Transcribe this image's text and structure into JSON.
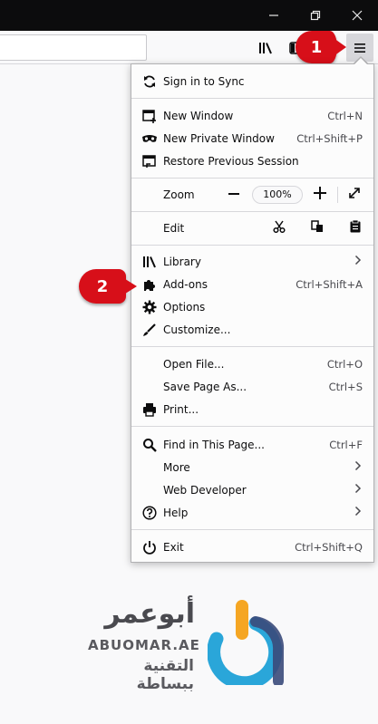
{
  "window_controls": {
    "minimize": "—",
    "maximize": "❐",
    "close": "✕"
  },
  "annotations": {
    "step1": "1",
    "step2": "2"
  },
  "menu": {
    "sign_in": "Sign in to Sync",
    "new_window": {
      "label": "New Window",
      "shortcut": "Ctrl+N"
    },
    "private_window": {
      "label": "New Private Window",
      "shortcut": "Ctrl+Shift+P"
    },
    "restore_session": {
      "label": "Restore Previous Session"
    },
    "zoom": {
      "label": "Zoom",
      "minus": "—",
      "value": "100%",
      "plus": "+"
    },
    "edit": {
      "label": "Edit"
    },
    "library": {
      "label": "Library"
    },
    "addons": {
      "label": "Add-ons",
      "shortcut": "Ctrl+Shift+A"
    },
    "options": {
      "label": "Options"
    },
    "customize": {
      "label": "Customize..."
    },
    "open_file": {
      "label": "Open File...",
      "shortcut": "Ctrl+O"
    },
    "save_page": {
      "label": "Save Page As...",
      "shortcut": "Ctrl+S"
    },
    "print": {
      "label": "Print..."
    },
    "find": {
      "label": "Find in This Page...",
      "shortcut": "Ctrl+F"
    },
    "more": {
      "label": "More"
    },
    "web_developer": {
      "label": "Web Developer"
    },
    "help": {
      "label": "Help"
    },
    "exit": {
      "label": "Exit",
      "shortcut": "Ctrl+Shift+Q"
    }
  },
  "watermark": {
    "arabic_name": "أبوعمر",
    "english_name": "ABUOMAR.AE",
    "tagline": "التقنية ببساطة"
  },
  "colors": {
    "badge": "#d70f19",
    "logo_orange": "#f5a623",
    "logo_blue": "#2aa6d9",
    "logo_gray": "#4a4a4f"
  }
}
